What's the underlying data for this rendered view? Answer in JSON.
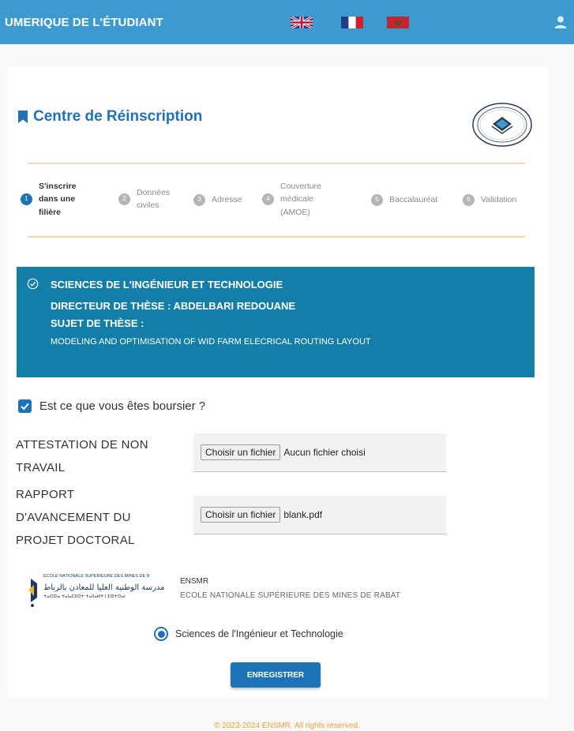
{
  "header": {
    "title": "UMERIQUE DE L'ÉTUDIANT",
    "languages": [
      "en-flag-icon",
      "fr-flag-icon",
      "ma-flag-icon"
    ],
    "accent_color": "#3d9ad1"
  },
  "page": {
    "title": "Centre de Réinscription",
    "title_icon": "bookmark-icon"
  },
  "steps": [
    {
      "number": "1",
      "label": "S'inscrire\ndans une\nfilière",
      "active": true
    },
    {
      "number": "2",
      "label": "Données\nciviles",
      "active": false
    },
    {
      "number": "3",
      "label": "Adresse",
      "active": false
    },
    {
      "number": "4",
      "label": "Couverture\nmédicale\n(AMOE)",
      "active": false
    },
    {
      "number": "5",
      "label": "Baccalauréat",
      "active": false
    },
    {
      "number": "6",
      "label": "Validation",
      "active": false
    }
  ],
  "info": {
    "filiere": "SCIENCES DE L'INGÉNIEUR ET TECHNOLOGIE",
    "directeur": "DIRECTEUR DE THÈSE : ABDELBARI REDOUANE",
    "sujet_label": "SUJET DE THÈSE :",
    "sujet": "MODELING AND OPTIMISATION OF WID FARM ELECRICAL ROUTING LAYOUT",
    "color": "#137ea8"
  },
  "boursier": {
    "label": "Est ce que vous êtes boursier ?",
    "checked": true
  },
  "files": [
    {
      "label": "ATTESTATION DE NON\nTRAVAIL",
      "button": "Choisir un fichier",
      "value": "Aucun fichier choisi"
    },
    {
      "label": "RAPPORT\nD'AVANCEMENT DU\nPROJET DOCTORAL",
      "button": "Choisir un fichier",
      "value": "blank.pdf"
    }
  ],
  "school": {
    "abbr": "ENSMR",
    "name": "ECOLE NATIONALE SUPÉRIEURE DES MINES DE RABAT",
    "logo_text": "ECOLE NATIONALE SUPERIEURE DES MINES DE R"
  },
  "radio": {
    "label": "Sciences de l'Ingénieur et Technologie",
    "selected": true
  },
  "save_label": "ENREGISTRER",
  "footer": "© 2023-2024 ENSMR. All rights reserved."
}
